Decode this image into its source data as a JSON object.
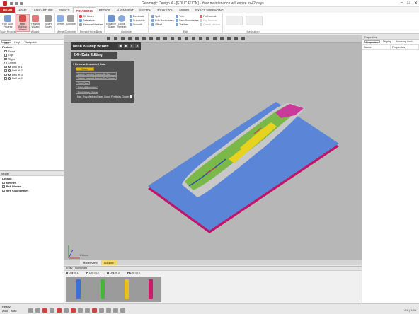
{
  "app": {
    "title": "Geomagic Design X - [EDUCATION] - Your maintenance will expire in 42 days"
  },
  "menubar": {
    "menu_label": "MENU",
    "tabs": [
      "HOME",
      "LIVECAPTURE",
      "POINTS",
      "POLYGONS",
      "REGION",
      "ALIGNMENT",
      "SKETCH",
      "3D SKETCH",
      "MODEL",
      "EXACT SURFACING"
    ],
    "active_tab": "POLYGONS"
  },
  "ribbon": {
    "scan_process": {
      "label": "Scan Process",
      "run_scan": "Run Scan Process"
    },
    "wizard_group": {
      "label": "Wizard",
      "buttons": [
        "Mesh Buildup Wizard",
        "Healing Wizard",
        "Smart Brush"
      ]
    },
    "merge_group": {
      "label": "Merge/Combine",
      "buttons": [
        "Merge",
        "Combine"
      ]
    },
    "repair_group": {
      "label": "Repair Holes Boss",
      "items": [
        "Fill Holes",
        "Defeature",
        "Remove Markers"
      ]
    },
    "optimize_group": {
      "label": "Optimize",
      "buttons": [
        "Enhance Shape",
        "Global Remesh"
      ],
      "items": [
        "Decimate",
        "Subdivide",
        "Smooth"
      ]
    },
    "edit_group": {
      "label": "Edit",
      "items": [
        "Split",
        "Edit Boundaries",
        "Offset",
        "Trim",
        "Sew Boundaries",
        "Thicken",
        "Fix Normal",
        "Flip Normal",
        "Check Normal"
      ]
    },
    "navigation_group": {
      "label": "Navigation"
    }
  },
  "left_panel": {
    "tabs": [
      "Tree",
      "Help",
      "Viewpoint"
    ],
    "feature_title": "Feature",
    "items": [
      "Front",
      "Top",
      "Right",
      "Origin",
      "Drill pt 1",
      "Drill pt 2",
      "Drill pt 3",
      "Drill pt 4"
    ]
  },
  "model_panel": {
    "title": "Model",
    "items": [
      "Default",
      "Meshes",
      "Ref. Planes",
      "Ref. Coordinates"
    ]
  },
  "wizard": {
    "title": "Mesh Buildup Wizard",
    "step": "2/4 - Data Editing",
    "section": "Remove Unwanted Data",
    "select_label": "Select",
    "buttons": [
      "Delete Inserted Region By Box",
      "Delete Inserted Region By Cylinder",
      "Find Floor",
      "Find All Boundary",
      "Find Heavy Cluster"
    ],
    "max_label": "Max. Poly-Vertices/Faces Count Per Noisy Cluster",
    "max_value": ""
  },
  "properties_panel": {
    "title": "Properties",
    "tabs": [
      "Properties",
      "Display",
      "Accuracy Anal..."
    ],
    "columns": [
      "Name",
      "Properties"
    ]
  },
  "viewport": {
    "scale_label": "0.6 mm",
    "tabs": [
      "Model View",
      "Support"
    ],
    "active_tab": "Support"
  },
  "thumbnails": {
    "title": "Entity Thumbnails",
    "labels": [
      "Drill pt 1",
      "Drill pt 2",
      "Drill pt 3",
      "Drill pt 4"
    ]
  },
  "statusbar": {
    "ready": "Ready",
    "mode": [
      "Auto",
      "Auto"
    ],
    "right": "0.0 | 0.06"
  },
  "colors": {
    "accent": "#c62828",
    "plate": "#5b85d6",
    "plate_edge": "#c0146a",
    "select_button": "#e5b800",
    "viewport_bg": "#b7b7b7"
  }
}
